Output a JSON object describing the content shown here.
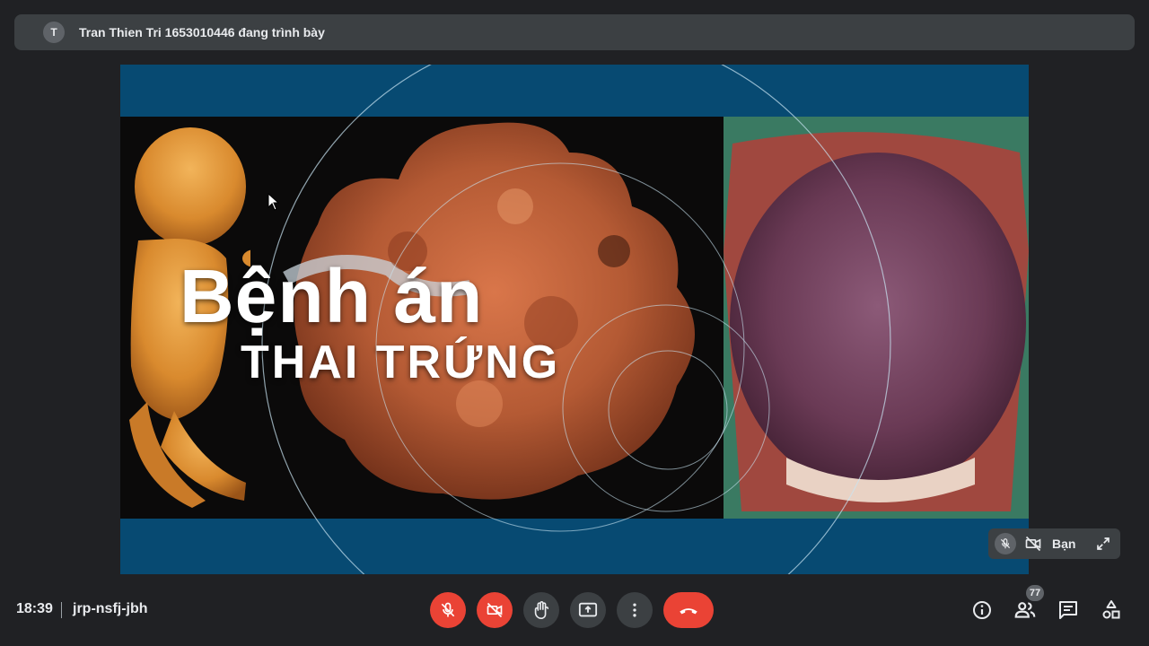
{
  "presenter_banner": {
    "avatar_initial": "T",
    "text": "Tran Thien Tri 1653010446 đang trình bày"
  },
  "slide": {
    "title": "Bệnh án",
    "subtitle": "THAI TRỨNG"
  },
  "self_view": {
    "name": "Bạn",
    "mic_icon": "mic-off-icon",
    "camera_icon": "camera-off-icon",
    "expand_icon": "expand-icon"
  },
  "bottom_bar": {
    "time": "18:39",
    "meeting_code": "jrp-nsfj-jbh",
    "participant_count": "77",
    "controls": [
      {
        "name": "mic-toggle-button",
        "icon": "mic-off-icon",
        "color": "#ea4335"
      },
      {
        "name": "camera-toggle-button",
        "icon": "camera-off-icon",
        "color": "#ea4335"
      },
      {
        "name": "raise-hand-button",
        "icon": "hand-icon",
        "color": "#3c4043"
      },
      {
        "name": "present-button",
        "icon": "present-screen-icon",
        "color": "#3c4043"
      },
      {
        "name": "more-options-button",
        "icon": "more-vert-icon",
        "color": "#3c4043"
      },
      {
        "name": "leave-call-button",
        "icon": "hangup-icon",
        "color": "#ea4335"
      }
    ],
    "right_controls": [
      "info-icon",
      "people-icon",
      "chat-icon",
      "activities-icon"
    ]
  },
  "colors": {
    "background": "#202124",
    "surface": "#3c4043",
    "danger": "#ea4335",
    "slide_blue": "#074a72"
  }
}
